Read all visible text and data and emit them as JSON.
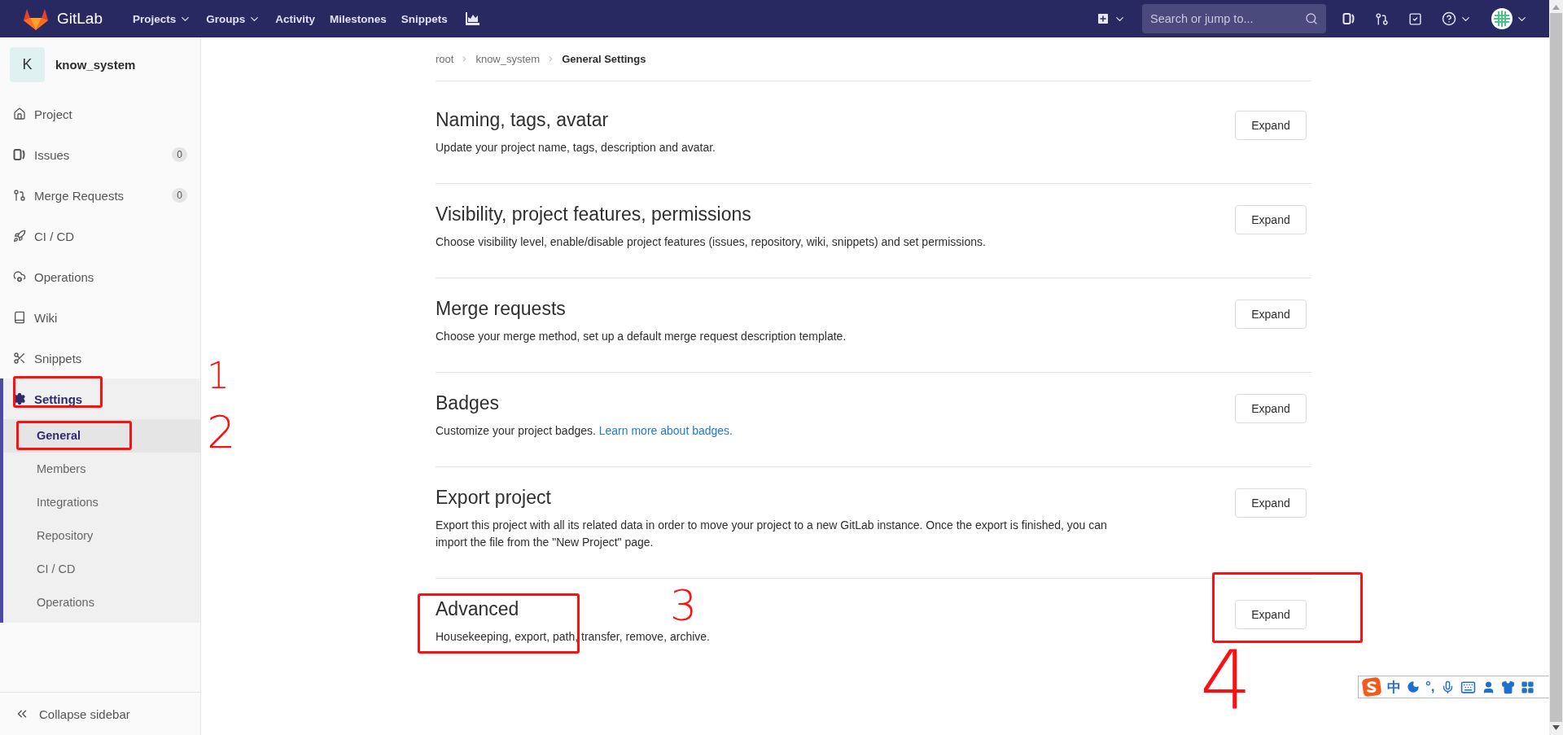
{
  "navbar": {
    "brand": "GitLab",
    "menu": [
      {
        "label": "Projects",
        "dropdown": true
      },
      {
        "label": "Groups",
        "dropdown": true
      },
      {
        "label": "Activity",
        "dropdown": false
      },
      {
        "label": "Milestones",
        "dropdown": false
      },
      {
        "label": "Snippets",
        "dropdown": false
      }
    ],
    "search": {
      "placeholder": "Search or jump to..."
    }
  },
  "sidebar": {
    "project": {
      "initial": "K",
      "name": "know_system"
    },
    "items": [
      {
        "label": "Project",
        "selected": false
      },
      {
        "label": "Issues",
        "count": "0",
        "selected": false
      },
      {
        "label": "Merge Requests",
        "count": "0",
        "selected": false
      },
      {
        "label": "CI / CD",
        "selected": false
      },
      {
        "label": "Operations",
        "selected": false
      },
      {
        "label": "Wiki",
        "selected": false
      },
      {
        "label": "Snippets",
        "selected": false
      },
      {
        "label": "Settings",
        "selected": true,
        "children": [
          {
            "label": "General",
            "selected": true
          },
          {
            "label": "Members",
            "selected": false
          },
          {
            "label": "Integrations",
            "selected": false
          },
          {
            "label": "Repository",
            "selected": false
          },
          {
            "label": "CI / CD",
            "selected": false
          },
          {
            "label": "Operations",
            "selected": false
          }
        ]
      }
    ],
    "collapse": "Collapse sidebar"
  },
  "breadcrumb": [
    "root",
    "know_system",
    "General Settings"
  ],
  "sections": [
    {
      "title": "Naming, tags, avatar",
      "description": "Update your project name, tags, description and avatar.",
      "button": "Expand"
    },
    {
      "title": "Visibility, project features, permissions",
      "description": "Choose visibility level, enable/disable project features (issues, repository, wiki, snippets) and set permissions.",
      "button": "Expand"
    },
    {
      "title": "Merge requests",
      "description": "Choose your merge method, set up a default merge request description template.",
      "button": "Expand"
    },
    {
      "title": "Badges",
      "description": "Customize your project badges.",
      "link": "Learn more about badges.",
      "button": "Expand"
    },
    {
      "title": "Export project",
      "description": "Export this project with all its related data in order to move your project to a new GitLab instance. Once the export is finished, you can import the file from the \"New Project\" page.",
      "button": "Expand"
    },
    {
      "title": "Advanced",
      "description": "Housekeeping, export, path, transfer, remove, archive.",
      "button": "Expand"
    }
  ],
  "annotations": [
    {
      "number": "1"
    },
    {
      "number": "2"
    },
    {
      "number": "3"
    },
    {
      "number": "4"
    }
  ],
  "ime_bar": {
    "mode": "中",
    "punctuation": "°,"
  }
}
